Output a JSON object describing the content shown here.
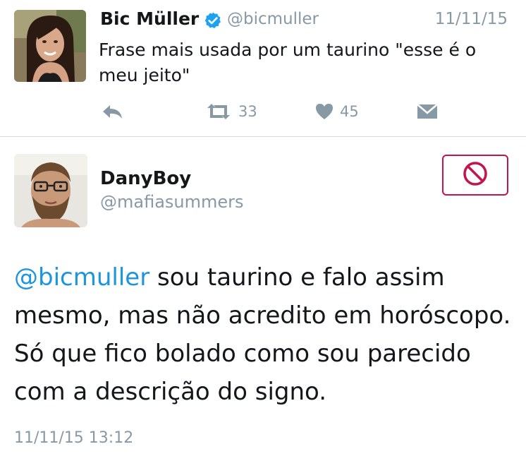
{
  "tweet1": {
    "author_name": "Bic Müller",
    "verified": true,
    "handle": "@bicmuller",
    "date": "11/11/15",
    "text": "Frase mais usada por um taurino \"esse é o meu jeito\"",
    "retweet_count": "33",
    "like_count": "45",
    "icons": {
      "reply": "reply-icon",
      "retweet": "retweet-icon",
      "like": "heart-icon",
      "dm": "envelope-icon",
      "verified": "verified-badge-icon"
    }
  },
  "tweet2": {
    "author_name": "DanyBoy",
    "handle": "@mafiasummers",
    "mention": "@bicmuller",
    "text": " sou taurino e falo assim mesmo, mas não acredito em horóscopo. Só que fico bolado como sou parecido com a descrição do signo.",
    "timestamp": "11/11/15 13:12",
    "block_icon": "block-icon"
  },
  "colors": {
    "link": "#1b95e0",
    "muted": "#8899a6",
    "verified": "#1da1f2",
    "block": "#c3144c"
  }
}
